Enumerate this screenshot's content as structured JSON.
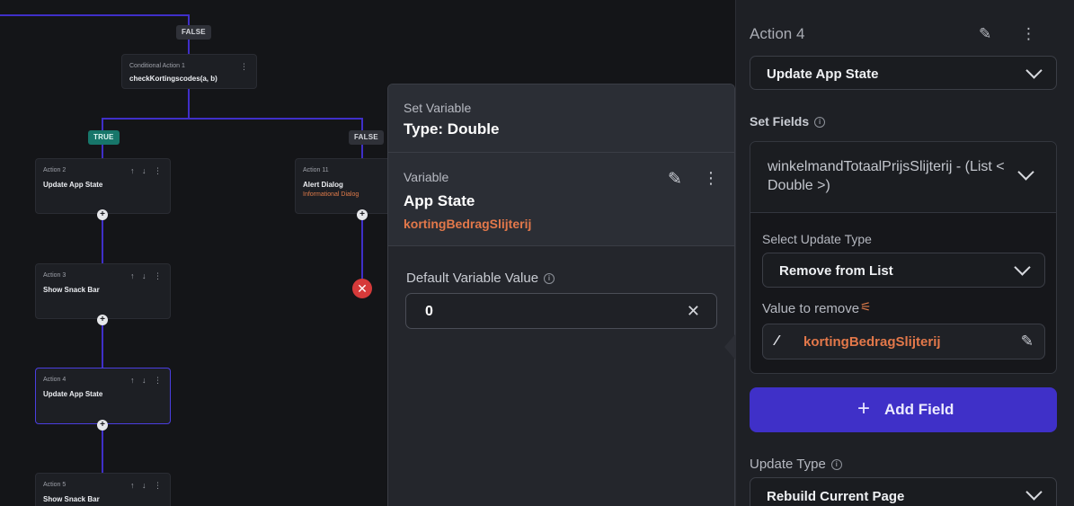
{
  "flow": {
    "false_top": "FALSE",
    "conditional": {
      "sub": "Conditional Action 1",
      "title": "checkKortingscodes(a, b)"
    },
    "true_chip": "TRUE",
    "false_chip": "FALSE",
    "actions": [
      {
        "sub": "Action 2",
        "title": "Update App State"
      },
      {
        "sub": "Action 3",
        "title": "Show Snack Bar"
      },
      {
        "sub": "Action 4",
        "title": "Update App State"
      },
      {
        "sub": "Action 5",
        "title": "Show Snack Bar"
      }
    ],
    "alert": {
      "sub": "Action 11",
      "title": "Alert Dialog",
      "desc": "Informational Dialog"
    },
    "node_controls": "↑ ↓ ⋮",
    "plus": "+",
    "stop": "✕"
  },
  "popup": {
    "set_variable_label": "Set Variable",
    "type_label": "Type: Double",
    "variable_label": "Variable",
    "source": "App State",
    "variable_name": "kortingBedragSlijterij",
    "default_label": "Default Variable Value",
    "default_value": "0",
    "edit_icon": "✎",
    "more_icon": "⋮",
    "clear_icon": "✕",
    "info": "i"
  },
  "panel": {
    "action_title": "Action 4",
    "header_icons": "✎ ⋮",
    "action_type": "Update App State",
    "set_fields_label": "Set Fields",
    "info": "i",
    "field_name": "winkelmandTotaalPrijsSlijterij - (List < Double >)",
    "select_update_type_label": "Select Update Type",
    "update_type_value": "Remove from List",
    "value_to_remove_label": "Value to remove",
    "tune_icon": "⚟",
    "value_icon": "⁄",
    "value": "kortingBedragSlijterij",
    "edit_icon": "✎",
    "add_field_plus": "+",
    "add_field": "Add Field",
    "update_type_label": "Update Type",
    "rebuild_value": "Rebuild Current Page"
  }
}
